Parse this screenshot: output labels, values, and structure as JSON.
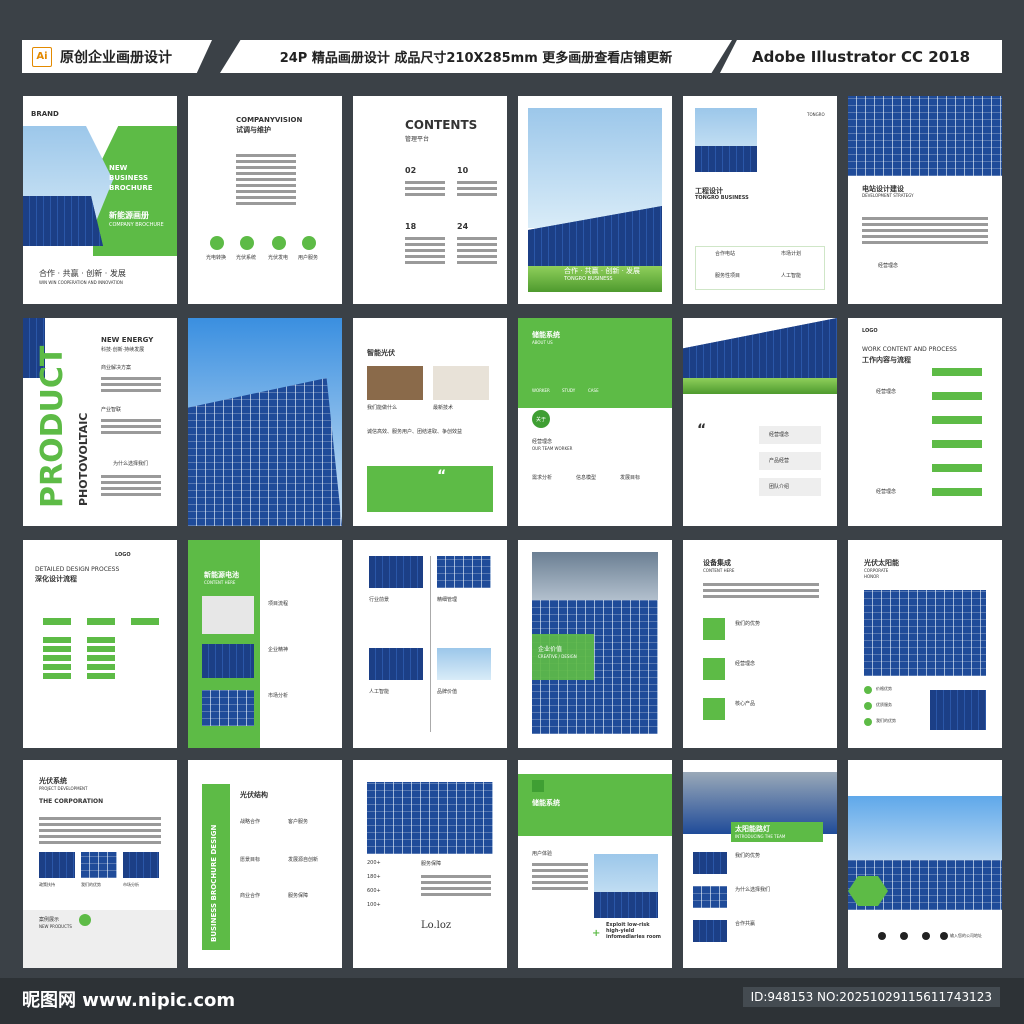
{
  "header": {
    "ai_badge": "Ai",
    "left_title": "原创企业画册设计",
    "center_title": "24P 精品画册设计 成品尺寸210X285mm 更多画册查看店铺更新",
    "right_title": "Adobe Illustrator CC 2018"
  },
  "pages": {
    "p1": {
      "brand": "BRAND",
      "title1": "NEW",
      "title2": "BUSINESS",
      "title3": "BROCHURE",
      "cn": "新能源画册",
      "sub": "COMPANY BROCHURE",
      "slogan": "合作 · 共赢 · 创新 · 发展",
      "slogan_en": "WIN WIN COOPERATION AND INNOVATION"
    },
    "p2": {
      "title_en": "COMPANYVISION",
      "title_cn": "试调与维护",
      "icons": [
        "光电转换",
        "光伏系统",
        "光伏发电",
        "用户服务"
      ]
    },
    "p3": {
      "title": "CONTENTS",
      "sub": "管理平台",
      "nums": [
        "02",
        "10",
        "18",
        "24"
      ]
    },
    "p4": {
      "slogan": "合作 · 共赢 · 创新 · 发展",
      "sub": "TONGRO BUSINESS"
    },
    "p5": {
      "brand": "TONGRO",
      "cn": "工程设计",
      "en": "TONGRO BUSINESS",
      "items": [
        "合作电站",
        "市场计划",
        "服务性项目",
        "人工智能"
      ]
    },
    "p6": {
      "cn": "电站设计建设",
      "en": "DEVELOPMENT STRATEGY",
      "label": "经营理念"
    },
    "p7": {
      "vertical1": "PRODUCT",
      "vertical2": "PHOTOVOLTAIC",
      "title": "NEW ENERGY",
      "sub": "科技·创新·持续发展",
      "l1": "商业解决方案",
      "l2": "产业智联",
      "l3": "为什么选择我们"
    },
    "p9": {
      "title": "智能光伏",
      "c1": "我们能做什么",
      "c2": "最新技术",
      "bar": "诚信高效、服务用户、团结进取、争创效益",
      "q": "“"
    },
    "p10": {
      "title": "储能系统",
      "sub": "ABOUT US",
      "tabs": [
        "WORKER",
        "STUDY",
        "CASE"
      ],
      "about": "关于",
      "l1": "经营理念",
      "l1en": "OUR TEAM WORKER",
      "cols": [
        "需求分析",
        "信息模型",
        "发展目标"
      ]
    },
    "p11": {
      "q": "“",
      "items": [
        "经营理念",
        "产品经营",
        "团队介绍"
      ]
    },
    "p12": {
      "logo": "LOGO",
      "en": "WORK CONTENT AND PROCESS",
      "cn": "工作内容与流程",
      "l1": "经营理念",
      "l2": "经营理念"
    },
    "p13": {
      "logo": "LOGO",
      "en": "DETAILED DESIGN PROCESS",
      "cn": "深化设计流程"
    },
    "p14": {
      "cn": "新能源电池",
      "en": "CONTENT HERE",
      "items": [
        "项目流程",
        "企业精神",
        "市场分析"
      ]
    },
    "p15": {
      "c": [
        "行业前景",
        "精细管理",
        "人工智能",
        "品牌价值"
      ]
    },
    "p16": {
      "cn": "企业价值",
      "en": "CREATIVE / DESIGN"
    },
    "p17": {
      "cn": "设备集成",
      "en": "CONTENT HERE",
      "items": [
        "我们的优势",
        "经营理念",
        "核心产品"
      ]
    },
    "p18": {
      "cn": "光伏太阳能",
      "en1": "CORPORATE",
      "en2": "HONOR",
      "items": [
        "价格优势",
        "优质服务",
        "我们的优势"
      ]
    },
    "p19": {
      "cn": "光伏系统",
      "en": "PROJECT DEVELOPMENT",
      "en2": "THE CORPORATION",
      "caps": [
        "政策扶持",
        "我们的优势",
        "市场分析"
      ],
      "case": "案例展示",
      "case_en": "NEW PRODUCTS"
    },
    "p20": {
      "vertical": "BUSINESS BROCHURE DESIGN",
      "title": "光伏结构",
      "items": [
        "战略合作",
        "客户服务",
        "愿景目标",
        "发展源自创新",
        "商业合作",
        "服务保障"
      ]
    },
    "p21": {
      "nums": [
        "200+",
        "180+",
        "600+",
        "100+"
      ],
      "r": "服务保障",
      "l": "服务保障",
      "sig": "Lo.loz"
    },
    "p22": {
      "cn": "储能系统",
      "l1": "用户体验",
      "plus": "+",
      "eng": "Exploit low-risk high-yield infomediaries room"
    },
    "p23": {
      "cn": "太阳能路灯",
      "en": "INTRODUCING THE TEAM",
      "items": [
        "我们的优势",
        "为什么选择我们",
        "合作共赢"
      ]
    },
    "p24": {
      "label": "输入您的公司地址"
    }
  },
  "footer": {
    "logo": "昵图网 www.nipic.com",
    "id": "ID:948153 NO:20251029115611743123"
  },
  "colors": {
    "accent": "#5dbb46",
    "bg": "#3b4147",
    "panel": "#1f4b99"
  }
}
